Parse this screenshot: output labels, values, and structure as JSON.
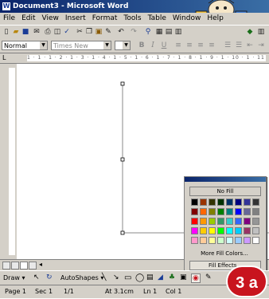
{
  "window": {
    "title": "Document3 - Microsoft Word",
    "app_icon": "W"
  },
  "menu": [
    "File",
    "Edit",
    "View",
    "Insert",
    "Format",
    "Tools",
    "Table",
    "Window",
    "Help"
  ],
  "formatting": {
    "style": "Normal",
    "font": "Times New Roman",
    "size": "",
    "bold": "B",
    "italic": "I",
    "underline": "U"
  },
  "ruler": {
    "ticks": "1 · 1 · 1 · 2 · 1 · 3 · 1 · 4 · 1 · 5 · 1 · 6 · 1 · 7 · 1 · 8 · 1 · 9 · 1 · 10 · 1 · 11 · 1 · 12 ·"
  },
  "fill_menu": {
    "no_fill": "No Fill",
    "more_colors": "More Fill Colors...",
    "fill_effects": "Fill Effects...",
    "colors": [
      [
        "#000000",
        "#993300",
        "#333300",
        "#003300",
        "#003366",
        "#000080",
        "#333399",
        "#333333"
      ],
      [
        "#800000",
        "#ff6600",
        "#808000",
        "#008000",
        "#008080",
        "#0000ff",
        "#666699",
        "#808080"
      ],
      [
        "#ff0000",
        "#ff9900",
        "#99cc00",
        "#339966",
        "#33cccc",
        "#3366ff",
        "#800080",
        "#969696"
      ],
      [
        "#ff00ff",
        "#ffcc00",
        "#ffff00",
        "#00ff00",
        "#00ffff",
        "#00ccff",
        "#993366",
        "#c0c0c0"
      ],
      [
        "#ff99cc",
        "#ffcc99",
        "#ffff99",
        "#ccffcc",
        "#ccffff",
        "#99ccff",
        "#cc99ff",
        "#ffffff"
      ]
    ]
  },
  "drawing": {
    "draw_label": "Draw",
    "autoshapes_label": "AutoShapes"
  },
  "status": {
    "page": "Page 1",
    "sec": "Sec 1",
    "pos": "1/1",
    "at": "At 3.1cm",
    "ln": "Ln 1",
    "col": "Col 1"
  },
  "badge": {
    "label": "3 a"
  },
  "colors": {
    "title_bar": "#0a246a",
    "chrome": "#d4d0c8",
    "badge": "#c8141e"
  }
}
